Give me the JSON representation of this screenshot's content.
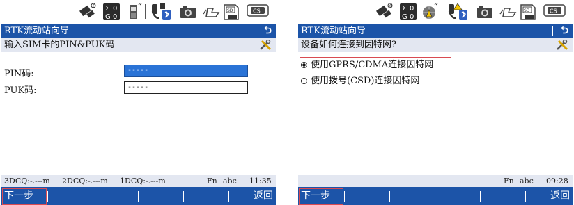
{
  "left": {
    "title": "RTK流动站向导",
    "back_glyph": "⮌",
    "subtitle": "输入SIM卡的PIN&PUK码",
    "fields": [
      {
        "label": "PIN码:",
        "value": "-----"
      },
      {
        "label": "PUK码:",
        "value": "-----"
      }
    ],
    "status": {
      "dcq3": "3DCQ:-.---m",
      "dcq2": "2DCQ:-.---m",
      "dcq1": "1DCQ:-.---m",
      "fn": "Fn",
      "abc": "abc",
      "time": "11:35"
    },
    "softkeys": {
      "next": "下一步",
      "back": "返回"
    },
    "sat_counts": [
      "0",
      "0"
    ],
    "sat_letters": [
      "Σ",
      "G"
    ]
  },
  "right": {
    "title": "RTK流动站向导",
    "back_glyph": "⮌",
    "subtitle": "设备如何连接到因特网?",
    "options": [
      {
        "label": "使用GPRS/CDMA连接因特网",
        "selected": true
      },
      {
        "label": "使用拨号(CSD)连接因特网",
        "selected": false
      }
    ],
    "status": {
      "fn": "Fn",
      "abc": "abc",
      "time": "09:28"
    },
    "softkeys": {
      "next": "下一步",
      "back": "返回"
    },
    "sat_counts": [
      "0",
      "0"
    ],
    "sat_letters": [
      "Σ",
      "G"
    ]
  },
  "status_icons": {
    "cs_label": "CS",
    "sd_label": "SD"
  },
  "colors": {
    "title_bar": "#1c54a8",
    "subtitle_bar": "#e3e7f1",
    "highlight": "#d94b52",
    "selected_field": "#2a73d6"
  }
}
